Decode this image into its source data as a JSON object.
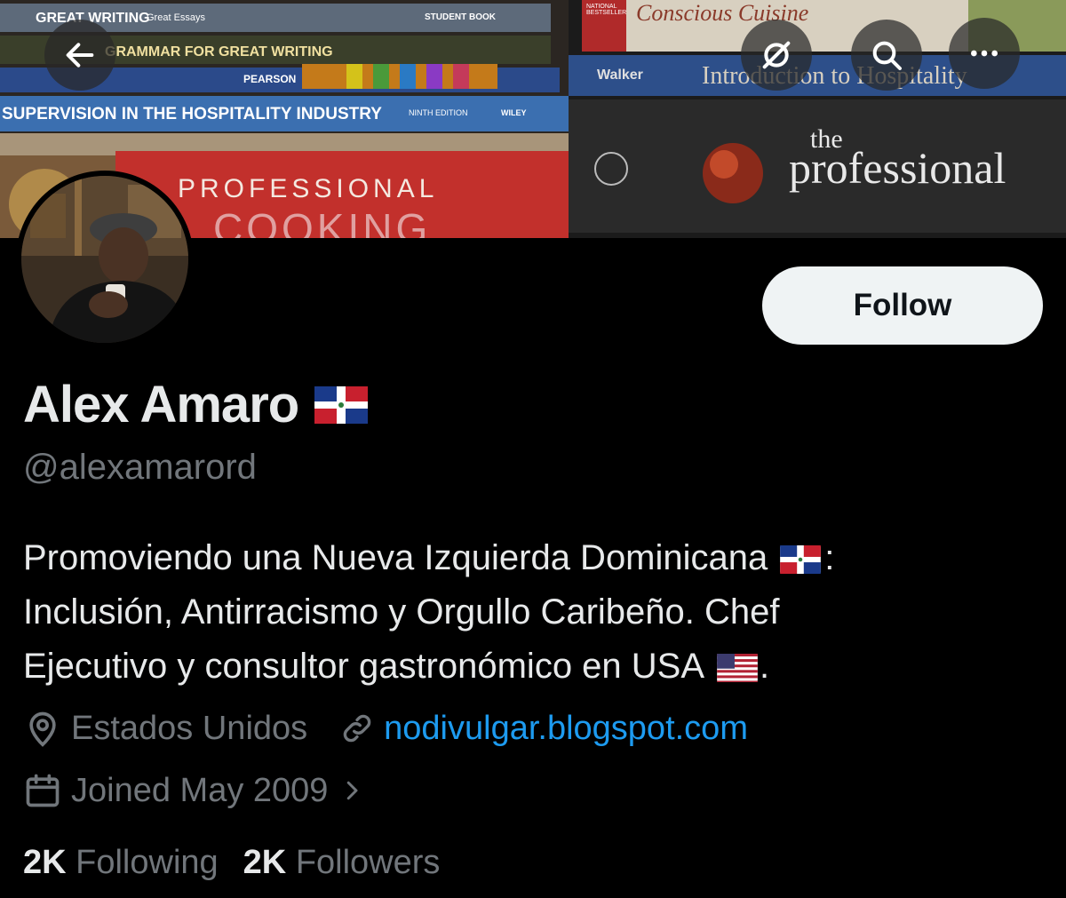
{
  "banner": {
    "book_titles": [
      "GREAT WRITING",
      "Great Essays",
      "STUDENT BOOK",
      "GRAMMAR FOR GREAT WRITING",
      "PEARSON",
      "SUPERVISION IN THE HOSPITALITY INDUSTRY",
      "NINTH EDITION",
      "WILEY",
      "PROFESSIONAL",
      "COOKING",
      "Conscious Cuisine",
      "NATIONAL BESTSELLER",
      "Walker",
      "Introduction to Hospitality",
      "the",
      "professional"
    ]
  },
  "header": {
    "back_icon": "arrow-left-icon",
    "hide_icon": "eye-slash-icon",
    "search_icon": "search-icon",
    "more_icon": "more-horizontal-icon"
  },
  "profile": {
    "display_name": "Alex Amaro",
    "handle": "@alexamarord",
    "follow_label": "Follow",
    "bio_lines": [
      "Promoviendo una Nueva Izquierda Dominicana",
      ":",
      "Inclusión, Antirracismo y Orgullo Caribeño. Chef",
      "Ejecutivo y consultor gastronómico en USA",
      "."
    ],
    "location": "Estados Unidos",
    "website": "nodivulgar.blogspot.com",
    "joined": "Joined May 2009",
    "following_count": "2K",
    "following_label": "Following",
    "followers_count": "2K",
    "followers_label": "Followers"
  },
  "colors": {
    "background": "#000000",
    "primary_text": "#e7e9ea",
    "secondary_text": "#71767b",
    "link": "#1d9bf0",
    "follow_bg": "#eff3f4"
  }
}
